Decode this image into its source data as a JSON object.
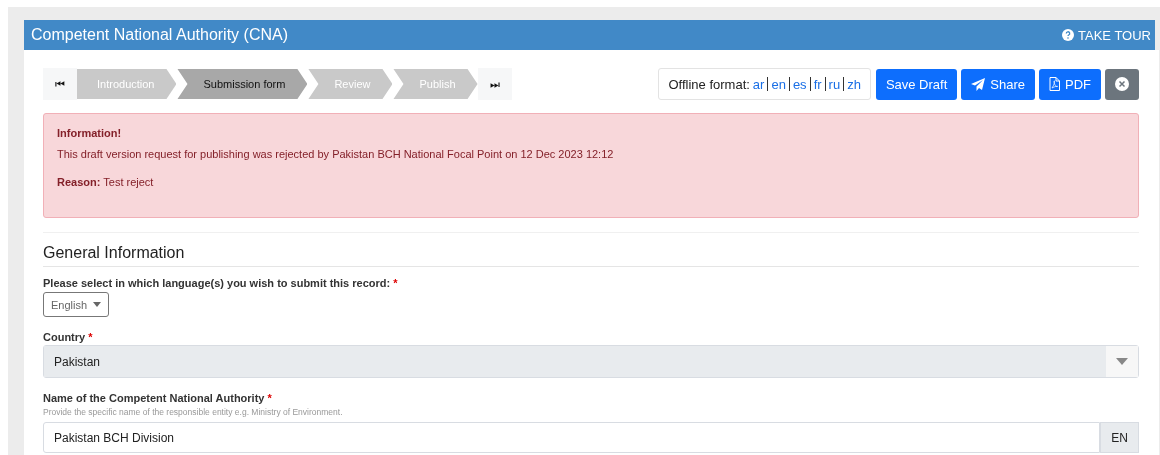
{
  "header": {
    "title": "Competent National Authority (CNA)",
    "tour": "TAKE TOUR"
  },
  "wizard": {
    "first": "⏮",
    "last": "⏭",
    "steps": [
      {
        "label": "Introduction",
        "selected": false
      },
      {
        "label": "Submission form",
        "selected": true
      },
      {
        "label": "Review",
        "selected": false
      },
      {
        "label": "Publish",
        "selected": false
      }
    ]
  },
  "offline": {
    "label": "Offline format:",
    "languages": [
      "ar",
      "en",
      "es",
      "fr",
      "ru",
      "zh"
    ]
  },
  "actions": [
    {
      "kind": "text",
      "label": "Save Draft"
    },
    {
      "kind": "share",
      "label": "Share"
    },
    {
      "kind": "pdf",
      "label": "PDF"
    },
    {
      "kind": "close"
    }
  ],
  "alert": {
    "title": "Information!",
    "message": "This draft version request for publishing was rejected by Pakistan BCH National Focal Point on 12 Dec 2023 12:12",
    "reason": "**Reason:** Test reject"
  },
  "section": {
    "title": "General Information"
  },
  "fields": [
    {
      "kind": "language",
      "label": "Please select in which language(s) you wish to submit this record:",
      "mark": "*",
      "value": "English"
    },
    {
      "kind": "select",
      "label": "Country",
      "mark": "*",
      "value": "Pakistan"
    },
    {
      "kind": "text",
      "label": "Name of the Competent National Authority",
      "mark": "*",
      "hint": "Provide the specific name of the responsible entity e.g. Ministry of Environment.",
      "value": "Pakistan BCH Division",
      "addon": "EN"
    }
  ]
}
